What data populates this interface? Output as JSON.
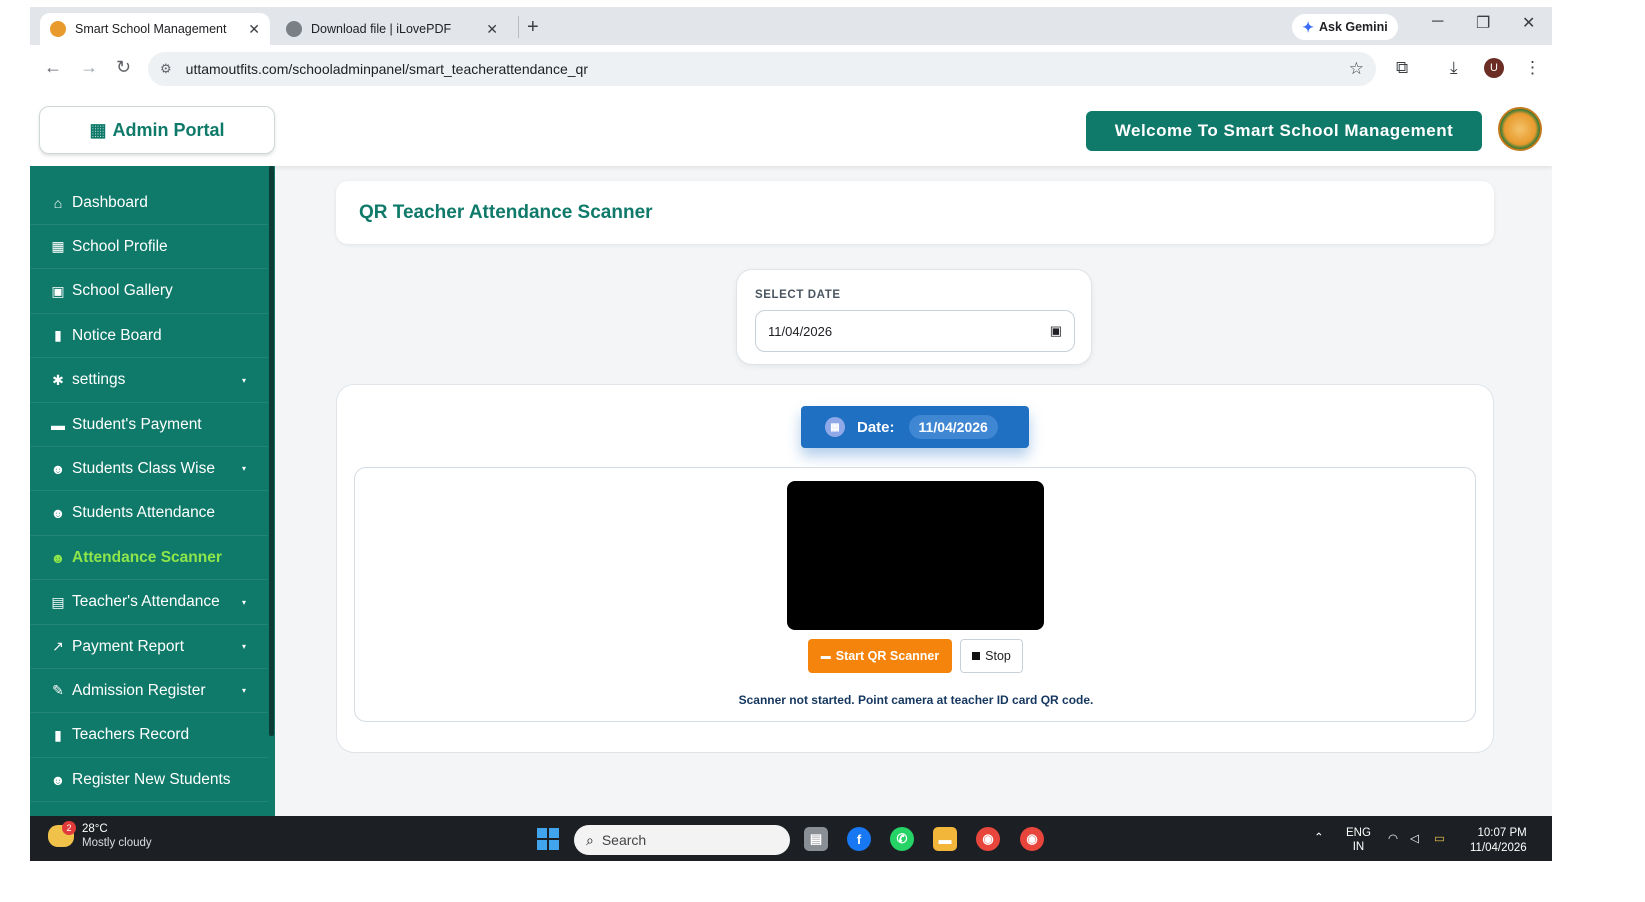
{
  "browser": {
    "tabs": [
      {
        "title": "Smart School Management",
        "active": true
      },
      {
        "title": "Download file | iLovePDF",
        "active": false
      }
    ],
    "new_tab_label": "+",
    "gemini_label": "Ask Gemini",
    "url": "uttamoutfits.com/schooladminpanel/smart_teacherattendance_qr",
    "profile_initial": "U"
  },
  "header": {
    "brand": "Admin Portal",
    "welcome": "Welcome To Smart School Management"
  },
  "sidebar": {
    "items": [
      {
        "label": "Dashboard",
        "icon": "home-icon",
        "glyph": "⌂",
        "caret": false,
        "active": false
      },
      {
        "label": "School Profile",
        "icon": "school-icon",
        "glyph": "▦",
        "caret": false,
        "active": false
      },
      {
        "label": "School Gallery",
        "icon": "camera-icon",
        "glyph": "▣",
        "caret": false,
        "active": false
      },
      {
        "label": "Notice Board",
        "icon": "clipboard-icon",
        "glyph": "▮",
        "caret": false,
        "active": false
      },
      {
        "label": "settings",
        "icon": "gear-icon",
        "glyph": "✱",
        "caret": true,
        "active": false
      },
      {
        "label": "Student's Payment",
        "icon": "credit-card-icon",
        "glyph": "▬",
        "caret": false,
        "active": false
      },
      {
        "label": "Students Class Wise",
        "icon": "users-icon",
        "glyph": "☻",
        "caret": true,
        "active": false
      },
      {
        "label": "Students Attendance",
        "icon": "user-check-icon",
        "glyph": "☻",
        "caret": false,
        "active": false
      },
      {
        "label": "Attendance Scanner",
        "icon": "user-check-icon",
        "glyph": "☻",
        "caret": false,
        "active": true
      },
      {
        "label": "Teacher's Attendance",
        "icon": "calendar-check-icon",
        "glyph": "▤",
        "caret": true,
        "active": false
      },
      {
        "label": "Payment Report",
        "icon": "chart-line-icon",
        "glyph": "↗",
        "caret": true,
        "active": false
      },
      {
        "label": "Admission Register",
        "icon": "file-signature-icon",
        "glyph": "✎",
        "caret": true,
        "active": false
      },
      {
        "label": "Teachers Record",
        "icon": "clipboard-icon",
        "glyph": "▮",
        "caret": false,
        "active": false
      },
      {
        "label": "Register New Students",
        "icon": "user-plus-icon",
        "glyph": "☻",
        "caret": false,
        "active": false
      }
    ],
    "caret_glyph": "▾"
  },
  "main": {
    "title": "QR Teacher Attendance Scanner",
    "date_card": {
      "label": "SELECT DATE",
      "value": "11/04/2026"
    },
    "scanner": {
      "date_label": "Date:",
      "date_value": "11/04/2026",
      "start_label": "Start QR Scanner",
      "stop_label": "Stop",
      "status": "Scanner not started. Point camera at teacher ID card QR code."
    }
  },
  "taskbar": {
    "weather_temp": "28°C",
    "weather_desc": "Mostly cloudy",
    "weather_badge": "2",
    "search_placeholder": "Search",
    "lang_top": "ENG",
    "lang_bottom": "IN",
    "time": "10:07 PM",
    "date": "11/04/2026"
  },
  "colors": {
    "primary": "#0f7a6a",
    "active_menu": "#8ee64b",
    "accent_orange": "#f5840c",
    "date_pill": "#1f6fc2"
  }
}
